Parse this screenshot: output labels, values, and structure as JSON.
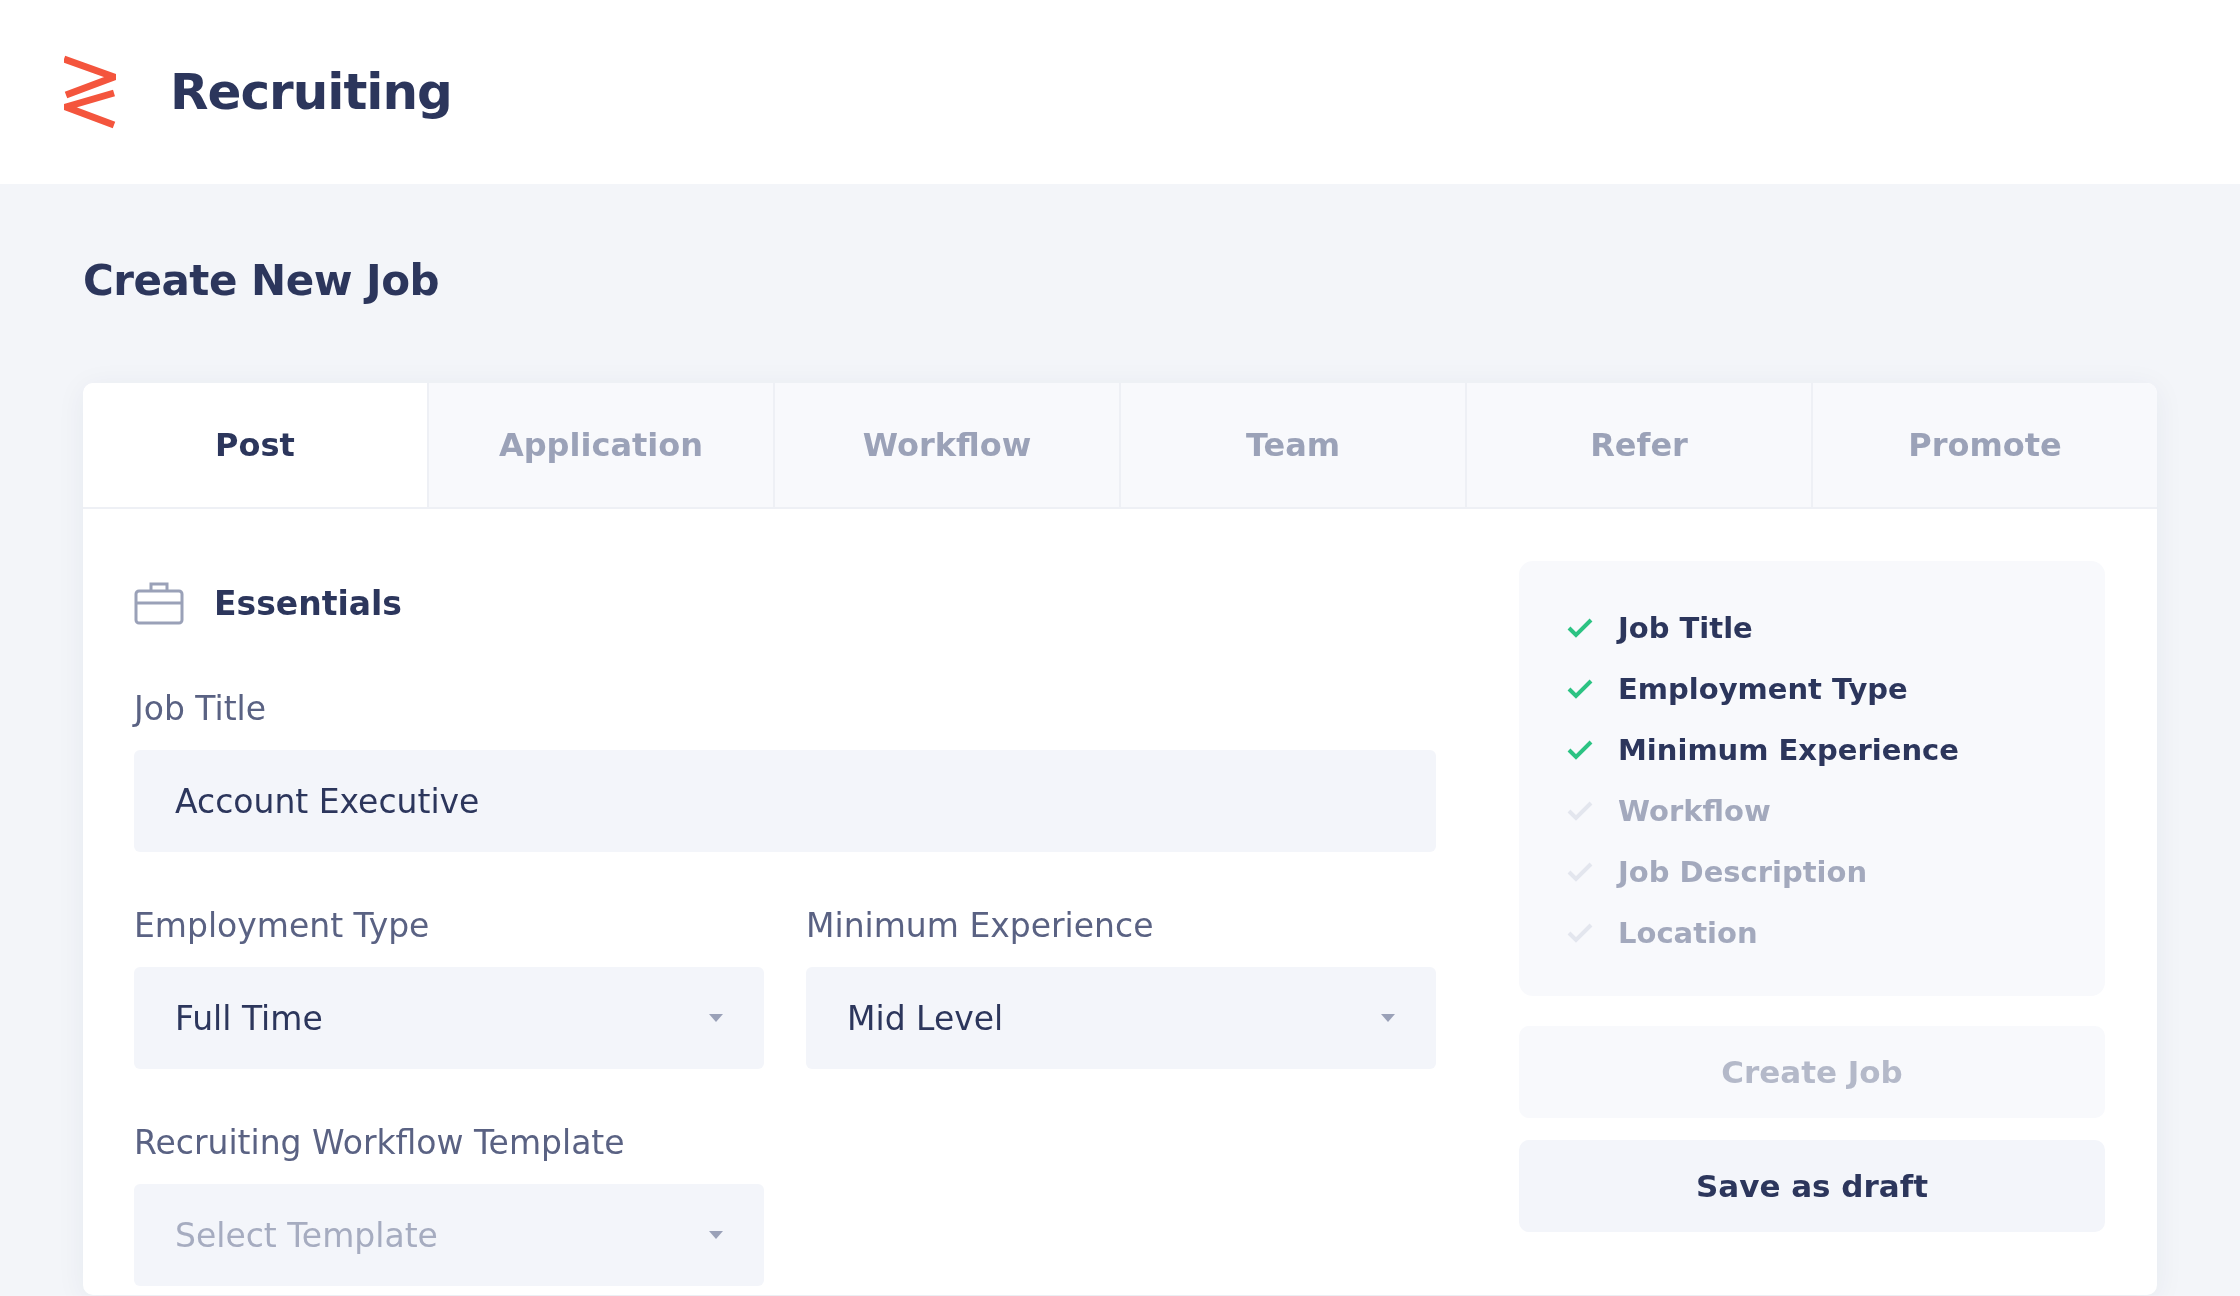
{
  "header": {
    "title": "Recruiting"
  },
  "page_title": "Create New Job",
  "tabs": [
    {
      "label": "Post",
      "selected": true
    },
    {
      "label": "Application",
      "selected": false
    },
    {
      "label": "Workflow",
      "selected": false
    },
    {
      "label": "Team",
      "selected": false
    },
    {
      "label": "Refer",
      "selected": false
    },
    {
      "label": "Promote",
      "selected": false
    }
  ],
  "section": {
    "title": "Essentials"
  },
  "form": {
    "job_title": {
      "label": "Job Title",
      "value": "Account Executive"
    },
    "employment_type": {
      "label": "Employment Type",
      "value": "Full Time"
    },
    "minimum_experience": {
      "label": "Minimum Experience",
      "value": "Mid Level"
    },
    "workflow_template": {
      "label": "Recruiting Workflow Template",
      "placeholder": "Select Template"
    }
  },
  "checklist": [
    {
      "label": "Job Title",
      "done": true
    },
    {
      "label": "Employment Type",
      "done": true
    },
    {
      "label": "Minimum Experience",
      "done": true
    },
    {
      "label": "Workflow",
      "done": false
    },
    {
      "label": "Job Description",
      "done": false
    },
    {
      "label": "Location",
      "done": false
    }
  ],
  "buttons": [
    {
      "label": "Create Job",
      "disabled": true
    },
    {
      "label": "Save as draft",
      "disabled": false
    }
  ]
}
